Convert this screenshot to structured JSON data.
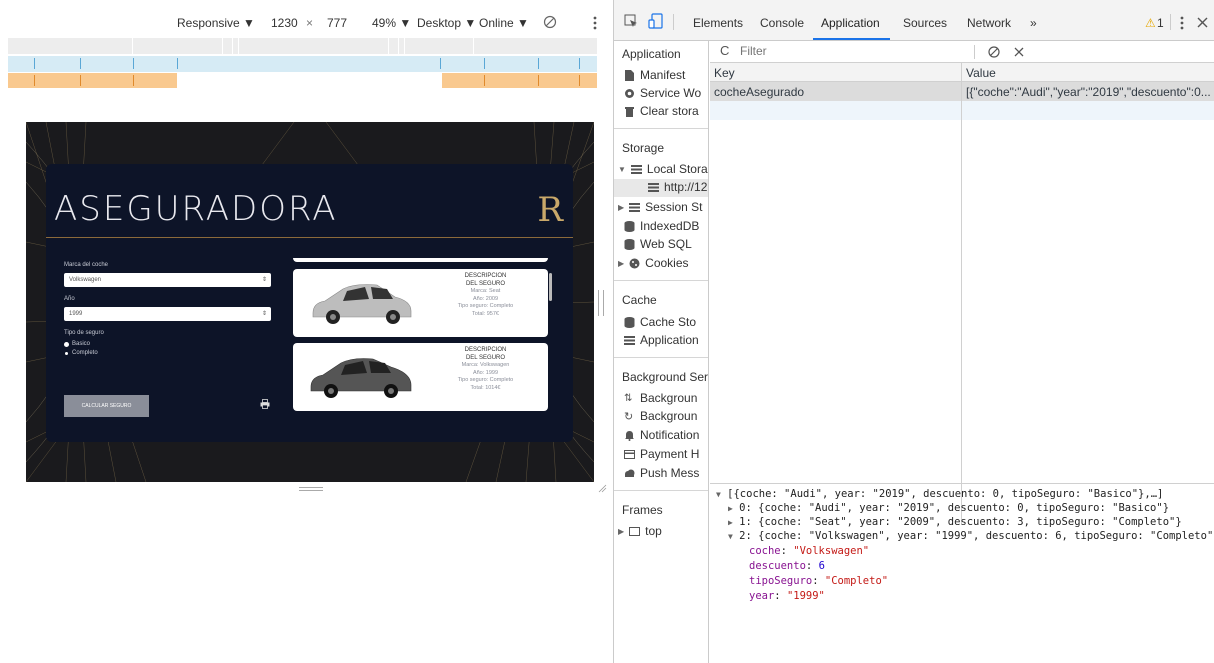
{
  "device_toolbar": {
    "device": "Responsive ▼",
    "width": "1230",
    "times": "×",
    "height": "777",
    "zoom": "49% ▼",
    "mode": "Desktop ▼",
    "throttle": "Online ▼"
  },
  "app": {
    "title": "ASEGURADORA",
    "logo": "R",
    "form": {
      "marca_label": "Marca del coche",
      "marca_value": "Volkswagen",
      "year_label": "Año",
      "year_value": "1999",
      "tipo_label": "Tipo de seguro",
      "options": [
        "Basico",
        "Completo"
      ],
      "submit_label": "CALCULAR SEGURO"
    },
    "results": [
      {
        "heading1": "DESCRIPCION",
        "heading2": "DEL SEGURO",
        "marca": "Marca: Seat",
        "year": "Año: 2009",
        "tipo": "Tipo seguro: Completo",
        "total": "Total: 957€",
        "car_color": "#bdbdbd"
      },
      {
        "heading1": "DESCRIPCION",
        "heading2": "DEL SEGURO",
        "marca": "Marca: Volkswagen",
        "year": "Año: 1999",
        "tipo": "Tipo seguro: Completo",
        "total": "Total: 1014€",
        "car_color": "#555555"
      }
    ]
  },
  "devtools": {
    "tabs": [
      "Elements",
      "Console",
      "Application",
      "Sources",
      "Network",
      "»"
    ],
    "active_tab": "Application",
    "warnings": "1",
    "warning_icon": "⚠",
    "sidebar": {
      "application_header": "Application",
      "application_items": [
        "Manifest",
        "Service Wo",
        "Clear stora"
      ],
      "storage_header": "Storage",
      "storage_items": [
        "Local Stora",
        "http://12",
        "Session St",
        "IndexedDB",
        "Web SQL",
        "Cookies"
      ],
      "cache_header": "Cache",
      "cache_items": [
        "Cache Sto",
        "Application"
      ],
      "bg_header": "Background Serv",
      "bg_items": [
        "Backgroun",
        "Backgroun",
        "Notification",
        "Payment H",
        "Push Mess"
      ],
      "frames_header": "Frames",
      "frames_items": [
        "top"
      ]
    },
    "filter_placeholder": "Filter",
    "table": {
      "col_key": "Key",
      "col_value": "Value",
      "row_key": "cocheAsegurado",
      "row_value": "[{\"coche\":\"Audi\",\"year\":\"2019\",\"descuento\":0..."
    },
    "preview": {
      "summary": "[{coche: \"Audi\", year: \"2019\", descuento: 0, tipoSeguro: \"Basico\"},…]",
      "item0": "0: {coche: \"Audi\", year: \"2019\", descuento: 0, tipoSeguro: \"Basico\"}",
      "item1": "1: {coche: \"Seat\", year: \"2009\", descuento: 3, tipoSeguro: \"Completo\"}",
      "item2": "2: {coche: \"Volkswagen\", year: \"1999\", descuento: 6, tipoSeguro: \"Completo\"}",
      "k_coche": "coche",
      "v_coche": "\"Volkswagen\"",
      "k_descuento": "descuento",
      "v_descuento": "6",
      "k_tipo": "tipoSeguro",
      "v_tipo": "\"Completo\"",
      "k_year": "year",
      "v_year": "\"1999\""
    }
  }
}
